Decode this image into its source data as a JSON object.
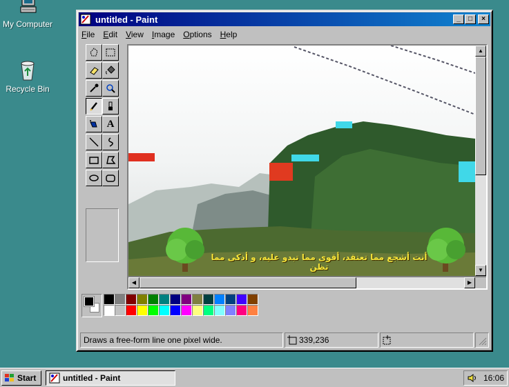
{
  "desktop": {
    "icons": [
      {
        "label": "My Computer",
        "icon": "computer-icon"
      },
      {
        "label": "Recycle Bin",
        "icon": "recycle-bin-icon"
      }
    ]
  },
  "window": {
    "title": "untitled - Paint",
    "controls": {
      "minimize": "_",
      "maximize": "□",
      "close": "×"
    }
  },
  "menu": [
    "File",
    "Edit",
    "View",
    "Image",
    "Options",
    "Help"
  ],
  "tools": [
    {
      "name": "free-form-select",
      "icon": "free-select-icon"
    },
    {
      "name": "select",
      "icon": "rect-select-icon"
    },
    {
      "name": "eraser",
      "icon": "eraser-icon"
    },
    {
      "name": "fill",
      "icon": "fill-bucket-icon"
    },
    {
      "name": "pick-color",
      "icon": "eyedropper-icon"
    },
    {
      "name": "magnifier",
      "icon": "magnifier-icon"
    },
    {
      "name": "pencil",
      "icon": "pencil-icon",
      "active": true
    },
    {
      "name": "brush",
      "icon": "brush-icon"
    },
    {
      "name": "airbrush",
      "icon": "airbrush-icon"
    },
    {
      "name": "text",
      "icon": "text-icon",
      "glyph": "A"
    },
    {
      "name": "line",
      "icon": "line-icon"
    },
    {
      "name": "curve",
      "icon": "curve-icon"
    },
    {
      "name": "rectangle",
      "icon": "rectangle-icon"
    },
    {
      "name": "polygon",
      "icon": "polygon-icon"
    },
    {
      "name": "ellipse",
      "icon": "ellipse-icon"
    },
    {
      "name": "rounded-rectangle",
      "icon": "rounded-rect-icon"
    }
  ],
  "canvas": {
    "caption": "أنت أشجع مما تعتقد، أقوى مما تبدو عليه، و أذكى مما تظن"
  },
  "palette": {
    "foreground": "#000000",
    "background": "#ffffff",
    "row1": [
      "#000000",
      "#808080",
      "#800000",
      "#808000",
      "#008000",
      "#008080",
      "#000080",
      "#800080",
      "#808040",
      "#004040",
      "#0080ff",
      "#004080",
      "#4000ff",
      "#804000"
    ],
    "row2": [
      "#ffffff",
      "#c0c0c0",
      "#ff0000",
      "#ffff00",
      "#00ff00",
      "#00ffff",
      "#0000ff",
      "#ff00ff",
      "#ffff80",
      "#00ff80",
      "#80ffff",
      "#8080ff",
      "#ff0080",
      "#ff8040"
    ]
  },
  "status": {
    "help": "Draws a free-form line one pixel wide.",
    "coords": "339,236",
    "size": ""
  },
  "taskbar": {
    "start": "Start",
    "task": "untitled - Paint",
    "clock": "16:06"
  }
}
